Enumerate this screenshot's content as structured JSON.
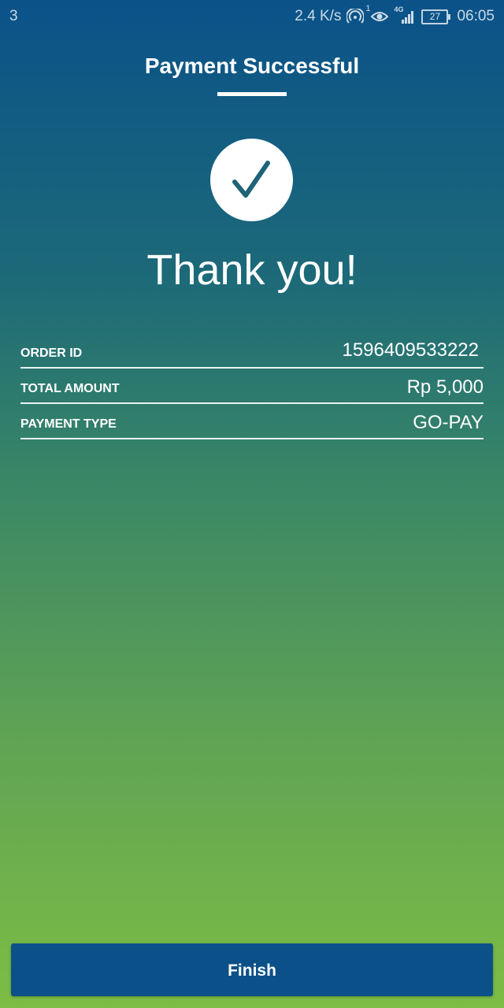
{
  "status_bar": {
    "notification_count": "3",
    "network_speed": "2.4 K/s",
    "hotspot_badge": "1",
    "network_type": "4G",
    "battery_level": "27",
    "time": "06:05"
  },
  "header": {
    "title": "Payment Successful"
  },
  "icons": {
    "success": "checkmark-icon"
  },
  "message": "Thank you!",
  "details": [
    {
      "label": "ORDER ID",
      "value": "1596409533222"
    },
    {
      "label": "TOTAL AMOUNT",
      "value": "Rp 5,000"
    },
    {
      "label": "PAYMENT TYPE",
      "value": "GO-PAY"
    }
  ],
  "actions": {
    "finish_label": "Finish"
  },
  "colors": {
    "gradient_top": "#0a5289",
    "gradient_bottom": "#7dbd44",
    "button": "#0c5089",
    "check_mark": "#1f6378"
  }
}
